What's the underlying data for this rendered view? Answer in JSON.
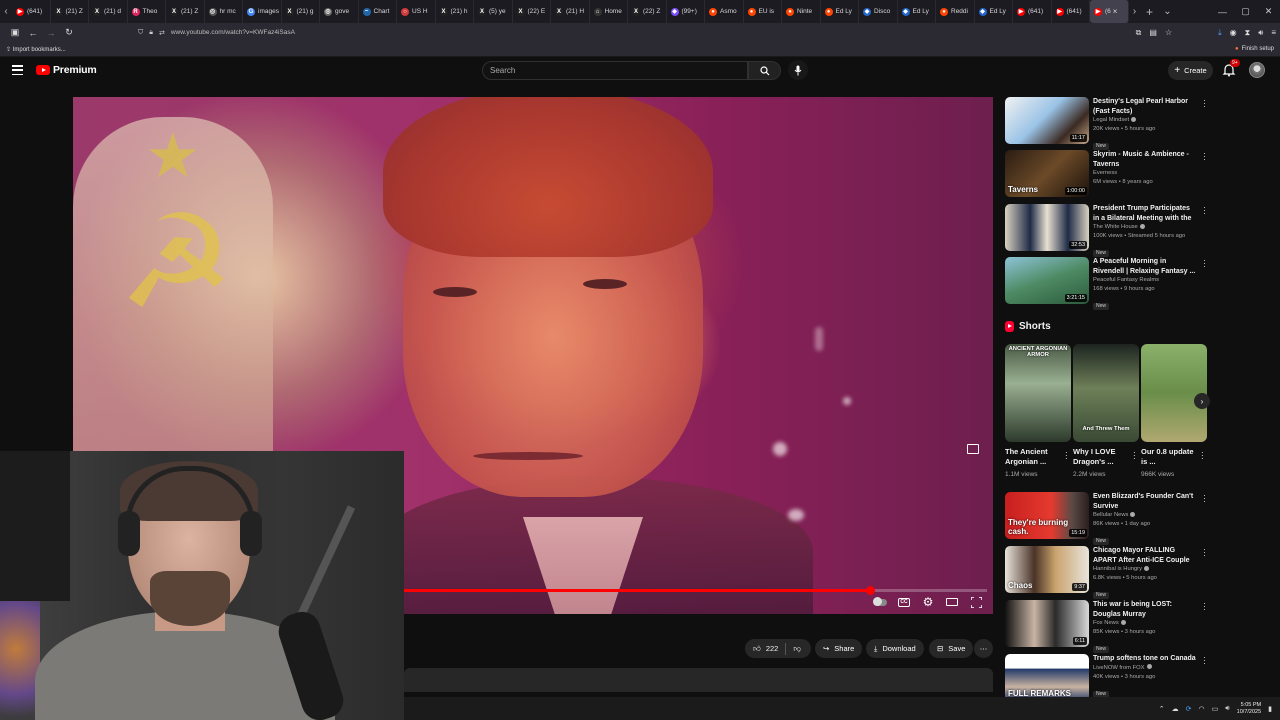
{
  "browser": {
    "tabs": [
      {
        "title": "(641)",
        "color": "#ff0000",
        "glyph": "▶"
      },
      {
        "title": "(21) Z",
        "color": "#222222",
        "glyph": "X"
      },
      {
        "title": "(21) d",
        "color": "#222222",
        "glyph": "X"
      },
      {
        "title": "Theo",
        "color": "#e0245e",
        "glyph": "R"
      },
      {
        "title": "(21) Z",
        "color": "#222222",
        "glyph": "X"
      },
      {
        "title": "hr mc",
        "color": "#555555",
        "glyph": "◎"
      },
      {
        "title": "images (",
        "color": "#4285f4",
        "glyph": "G"
      },
      {
        "title": "(21) g",
        "color": "#222222",
        "glyph": "X"
      },
      {
        "title": "gove",
        "color": "#666666",
        "glyph": "◎"
      },
      {
        "title": "Chart",
        "color": "#2266aa",
        "glyph": "~"
      },
      {
        "title": "US H",
        "color": "#d13a3a",
        "glyph": "○"
      },
      {
        "title": "(21) h",
        "color": "#222222",
        "glyph": "X"
      },
      {
        "title": "(5) ye",
        "color": "#222222",
        "glyph": "X"
      },
      {
        "title": "(22) E",
        "color": "#222222",
        "glyph": "X"
      },
      {
        "title": "(21) H",
        "color": "#222222",
        "glyph": "X"
      },
      {
        "title": "Home",
        "color": "#333333",
        "glyph": "⌂"
      },
      {
        "title": "(22) Z",
        "color": "#222222",
        "glyph": "X"
      },
      {
        "title": "(99+)",
        "color": "#7a4cff",
        "glyph": "◆"
      },
      {
        "title": "Asmo",
        "color": "#ff4500",
        "glyph": "●"
      },
      {
        "title": "EU is",
        "color": "#ff4500",
        "glyph": "●"
      },
      {
        "title": "Ninte",
        "color": "#ff4500",
        "glyph": "●"
      },
      {
        "title": "Ed Ly",
        "color": "#ff4500",
        "glyph": "●"
      },
      {
        "title": "Disco",
        "color": "#2266cc",
        "glyph": "◆"
      },
      {
        "title": "Ed Ly",
        "color": "#2266cc",
        "glyph": "◆"
      },
      {
        "title": "Reddi",
        "color": "#ff4500",
        "glyph": "●"
      },
      {
        "title": "Ed Ly",
        "color": "#2266cc",
        "glyph": "◆"
      },
      {
        "title": "(641)",
        "color": "#ff0000",
        "glyph": "▶"
      },
      {
        "title": "(641)",
        "color": "#ff0000",
        "glyph": "▶"
      },
      {
        "title": "(6",
        "color": "#ff0000",
        "glyph": "▶",
        "active": true
      }
    ],
    "url": "www.youtube.com/watch?v=KWFaz4iSasA",
    "bookmark_import": "Import bookmarks...",
    "finish_setup": "Finish setup"
  },
  "youtube": {
    "logo_text": "Premium",
    "search_placeholder": "Search",
    "create_label": "Create",
    "notif_count": "9+",
    "player": {
      "progress": 0.8
    },
    "actions": {
      "likes": "222",
      "share": "Share",
      "download": "Download",
      "save": "Save"
    },
    "recommendations": [
      {
        "title": "Destiny's Legal Pearl Harbor (Fast Facts)",
        "channel": "Legal Mindset",
        "verified": true,
        "meta": "20K views • 5 hours ago",
        "new": "New",
        "duration": "11:17",
        "thumb": "linear-gradient(135deg,#f2f2f2 0%,#9ac3e6 45%,#3b2a22 75%,#caa98a 100%)",
        "overlay": ""
      },
      {
        "title": "Skyrim - Music & Ambience - Taverns",
        "channel": "Everness",
        "verified": false,
        "meta": "6M views • 8 years ago",
        "new": "",
        "duration": "1:00:00",
        "thumb": "linear-gradient(135deg,#2b1c12 0%,#6b4a28 50%,#1b120c 100%)",
        "overlay": "Taverns"
      },
      {
        "title": "President Trump Participates in a Bilateral Meeting with the ...",
        "channel": "The White House",
        "verified": true,
        "meta": "100K views • Streamed 5 hours ago",
        "new": "New",
        "duration": "32:53",
        "thumb": "linear-gradient(90deg,#d9d2c2 0%,#1f2b47 30%,#e8e1d1 50%,#1f2b47 75%,#d9d2c2 100%)",
        "overlay": ""
      },
      {
        "title": "A Peaceful Morning in Rivendell | Relaxing Fantasy ...",
        "channel": "Peaceful Fantasy Realms",
        "verified": false,
        "meta": "168 views • 9 hours ago",
        "new": "New",
        "duration": "3:21:15",
        "thumb": "linear-gradient(160deg,#8ec3d8 0%,#4d8a63 50%,#2c5a3c 100%)",
        "overlay": ""
      },
      {
        "title": "Even Blizzard's Founder Can't Survive",
        "channel": "Bellular News",
        "verified": true,
        "meta": "86K views • 1 day ago",
        "new": "New",
        "duration": "15:19",
        "thumb": "linear-gradient(90deg,#c81f1f 0%,#e43a2f 55%,#5a4a46 80%,#2a1e1e 100%)",
        "overlay": "They're burning cash."
      },
      {
        "title": "Chicago Mayor FALLING APART After Anti-ICE Couple Arrested!",
        "channel": "Hannibal is Hungry",
        "verified": true,
        "meta": "6.8K views • 5 hours ago",
        "new": "New",
        "duration": "9:37",
        "thumb": "linear-gradient(90deg,#e9e4dc 0%,#4a3327 35%,#c9a36d 60%,#e9e4dc 100%)",
        "overlay": "Chaos"
      },
      {
        "title": "This war is being LOST: Douglas Murray",
        "channel": "Fox News",
        "verified": true,
        "meta": "85K views • 3 hours ago",
        "new": "New",
        "duration": "6:11",
        "thumb": "linear-gradient(90deg,#111 0%,#c9b4a4 35%,#2a2a2a 60%,#d8d8d8 100%)",
        "overlay": ""
      },
      {
        "title": "Trump softens tone on Canada",
        "channel": "LiveNOW from FOX",
        "verified": true,
        "meta": "40K views • 3 hours ago",
        "new": "New",
        "duration": "",
        "thumb": "linear-gradient(180deg,#ffffff 0%,#ffffff 30%,#233a6b 32%,#c9b3a1 70%,#233a6b 100%)",
        "overlay": "FULL REMARKS"
      }
    ],
    "shorts": {
      "heading": "Shorts",
      "items": [
        {
          "title": "The Ancient Argonian ...",
          "views": "1.1M views",
          "caption": "ANCIENT ARGONIAN ARMOR",
          "thumb": "linear-gradient(180deg,#4a5a46 0%,#9ab091 40%,#2d3a2c 100%)"
        },
        {
          "title": "Why I LOVE Dragon's ...",
          "views": "2.2M views",
          "caption": "And Threw Them",
          "thumb": "linear-gradient(180deg,#1d241f 0%,#6e8059 45%,#3a4a34 100%)"
        },
        {
          "title": "Our 0.8 update is ...",
          "views": "966K views",
          "caption": "",
          "thumb": "linear-gradient(180deg,#8ab06a 0%,#6a8e4a 50%,#b0a870 100%)"
        }
      ]
    }
  },
  "taskbar": {
    "time": "5:05 PM",
    "date": "10/7/2025"
  }
}
